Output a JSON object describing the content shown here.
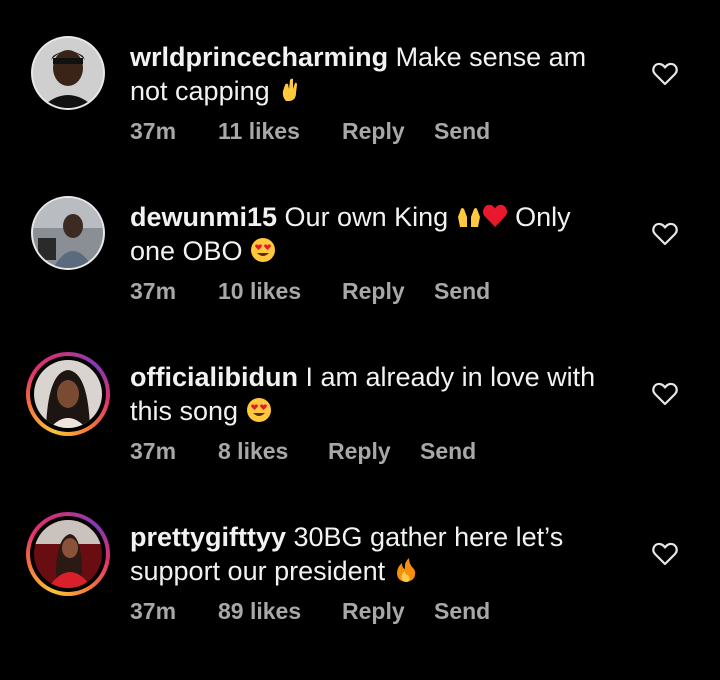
{
  "comments": [
    {
      "username": "wrldprincecharming",
      "text": " Make sense am not capping ",
      "emoji": "crossed-fingers",
      "time": "37m",
      "likes": "11 likes",
      "reply_label": "Reply",
      "send_label": "Send",
      "has_story_ring": false
    },
    {
      "username": "dewunmi15",
      "text": " Our own King ",
      "text2": " Only one OBO ",
      "emojis": [
        "raising-hands",
        "red-heart",
        "heart-eyes"
      ],
      "time": "37m",
      "likes": "10 likes",
      "reply_label": "Reply",
      "send_label": "Send",
      "has_story_ring": false
    },
    {
      "username": "officialibidun",
      "text": " I am already in love with this song ",
      "emoji": "heart-eyes",
      "time": "37m",
      "likes": "8 likes",
      "reply_label": "Reply",
      "send_label": "Send",
      "has_story_ring": true
    },
    {
      "username": "prettygifttyy",
      "text": " 30BG gather here let’s support our president ",
      "emoji": "fire",
      "time": "37m",
      "likes": "89 likes",
      "reply_label": "Reply",
      "send_label": "Send",
      "has_story_ring": true
    }
  ],
  "colors": {
    "background": "#000000",
    "text": "#f2f2f2",
    "muted": "#a8a8a8"
  }
}
